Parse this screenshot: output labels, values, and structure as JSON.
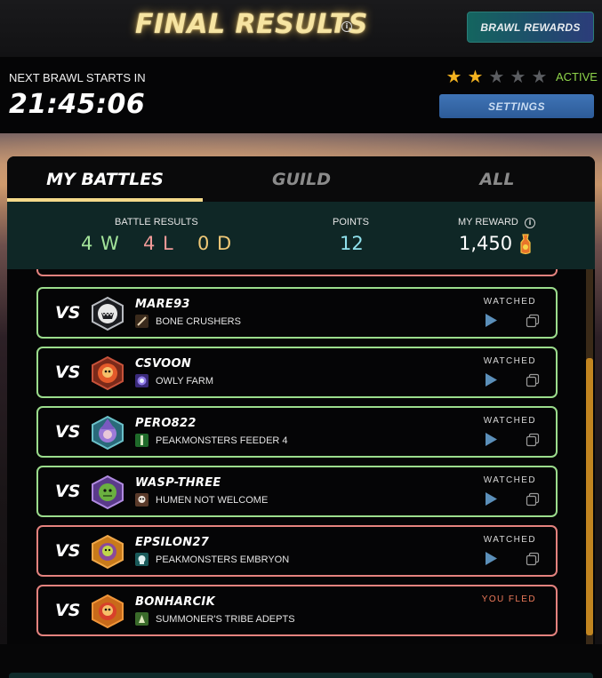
{
  "header": {
    "title": "FINAL RESULTS",
    "brawl_rewards_label": "BRAWL REWARDS"
  },
  "timer": {
    "label": "NEXT BRAWL STARTS IN",
    "value": "21:45:06",
    "stars_filled": 2,
    "stars_total": 5,
    "status": "ACTIVE",
    "settings_label": "SETTINGS"
  },
  "tabs": [
    {
      "label": "MY BATTLES",
      "active": true
    },
    {
      "label": "GUILD",
      "active": false
    },
    {
      "label": "ALL",
      "active": false
    }
  ],
  "summary": {
    "battle_results_label": "BATTLE RESULTS",
    "wins": "4 W",
    "losses": "4 L",
    "draws": "0 D",
    "points_label": "POINTS",
    "points": "12",
    "reward_label": "MY REWARD",
    "reward": "1,450"
  },
  "battles": [
    {
      "vs": "VS",
      "opponent": "MARE93",
      "guild": "BONE CRUSHERS",
      "status": "WATCHED",
      "result": "win",
      "avatar_icon": "monster-mask-icon",
      "guild_icon": "bone-crushers-guild-icon"
    },
    {
      "vs": "VS",
      "opponent": "CSVOON",
      "guild": "OWLY FARM",
      "status": "WATCHED",
      "result": "win",
      "avatar_icon": "fire-summoner-icon",
      "guild_icon": "owly-farm-guild-icon"
    },
    {
      "vs": "VS",
      "opponent": "PERO822",
      "guild": "PEAKMONSTERS FEEDER 4",
      "status": "WATCHED",
      "result": "win",
      "avatar_icon": "wizard-icon",
      "guild_icon": "peakmonsters-guild-icon"
    },
    {
      "vs": "VS",
      "opponent": "WASP-THREE",
      "guild": "HUMEN NOT WELCOME",
      "status": "WATCHED",
      "result": "win",
      "avatar_icon": "goblin-icon",
      "guild_icon": "humen-guild-icon"
    },
    {
      "vs": "VS",
      "opponent": "EPSILON27",
      "guild": "PEAKMONSTERS EMBRYON",
      "status": "WATCHED",
      "result": "loss",
      "avatar_icon": "plant-monster-icon",
      "guild_icon": "embryon-guild-icon"
    },
    {
      "vs": "VS",
      "opponent": "BONHARCIK",
      "guild": "SUMMONER'S TRIBE ADEPTS",
      "status": "YOU FLED",
      "result": "loss",
      "avatar_icon": "fire-summoner-icon",
      "guild_icon": "tribe-guild-icon"
    }
  ],
  "colors": {
    "win_border": "#9bdc8c",
    "loss_border": "#e4827e",
    "accent_gold": "#f4d98a",
    "active_green": "#8fd44a",
    "fled": "#ee7a5a"
  }
}
